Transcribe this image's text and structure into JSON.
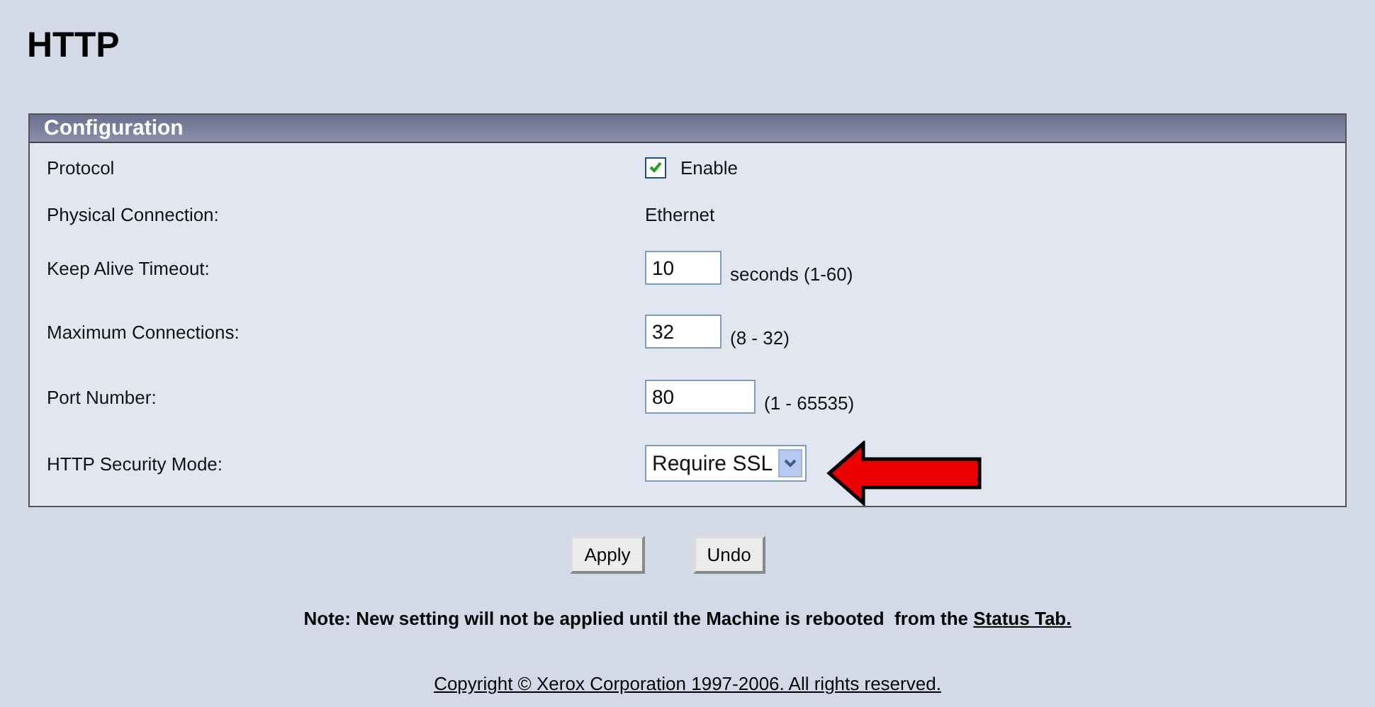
{
  "page_title": "HTTP",
  "panel": {
    "title": "Configuration",
    "rows": [
      {
        "kind": "checkbox",
        "label": "Protocol",
        "checked": true,
        "text": "Enable"
      },
      {
        "kind": "text",
        "label": "Physical Connection:",
        "value": "Ethernet"
      },
      {
        "kind": "number",
        "label": "Keep Alive Timeout:",
        "value": "10",
        "hint": "seconds (1-60)",
        "wide": false
      },
      {
        "kind": "number",
        "label": "Maximum Connections:",
        "value": "32",
        "hint": "(8 - 32)",
        "wide": false
      },
      {
        "kind": "number",
        "label": "Port Number:",
        "value": "80",
        "hint": "(1 - 65535)",
        "wide": true
      },
      {
        "kind": "select",
        "label": "HTTP Security Mode:",
        "value": "Require SSL",
        "annotated": true
      }
    ]
  },
  "buttons": [
    "Apply",
    "Undo"
  ],
  "note": {
    "text": "Note: New setting will not be applied until the Machine is rebooted  from the",
    "link": "Status Tab."
  },
  "copyright": "Copyright © Xerox Corporation 1997-2006. All rights reserved."
}
